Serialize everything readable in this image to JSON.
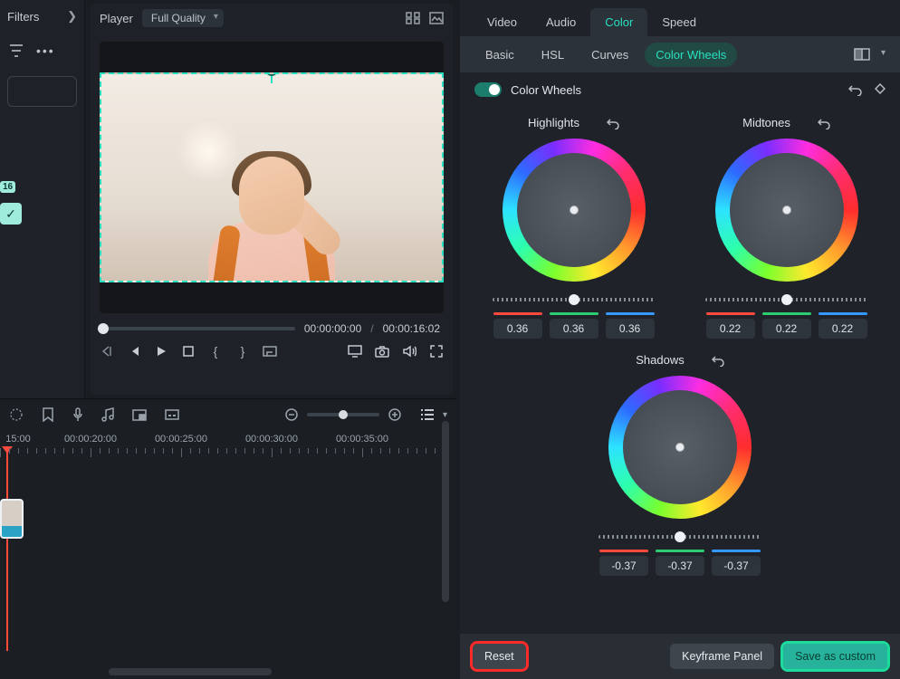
{
  "leftPanel": {
    "title": "Filters",
    "tagBadge": "16"
  },
  "player": {
    "title": "Player",
    "qualityLabel": "Full Quality",
    "currentTime": "00:00:00:00",
    "duration": "00:00:16:02"
  },
  "timeline": {
    "labels": [
      "15:00",
      "00:00:20:00",
      "00:00:25:00",
      "00:00:30:00",
      "00:00:35:00"
    ]
  },
  "inspector": {
    "mainTabs": [
      "Video",
      "Audio",
      "Color",
      "Speed"
    ],
    "activeMain": "Color",
    "subTabs": [
      "Basic",
      "HSL",
      "Curves",
      "Color Wheels"
    ],
    "activeSub": "Color Wheels",
    "sectionTitle": "Color Wheels",
    "wheels": [
      {
        "name": "Highlights",
        "r": "0.36",
        "g": "0.36",
        "b": "0.36"
      },
      {
        "name": "Midtones",
        "r": "0.22",
        "g": "0.22",
        "b": "0.22"
      },
      {
        "name": "Shadows",
        "r": "-0.37",
        "g": "-0.37",
        "b": "-0.37"
      }
    ]
  },
  "footer": {
    "reset": "Reset",
    "keyframe": "Keyframe Panel",
    "save": "Save as custom"
  }
}
